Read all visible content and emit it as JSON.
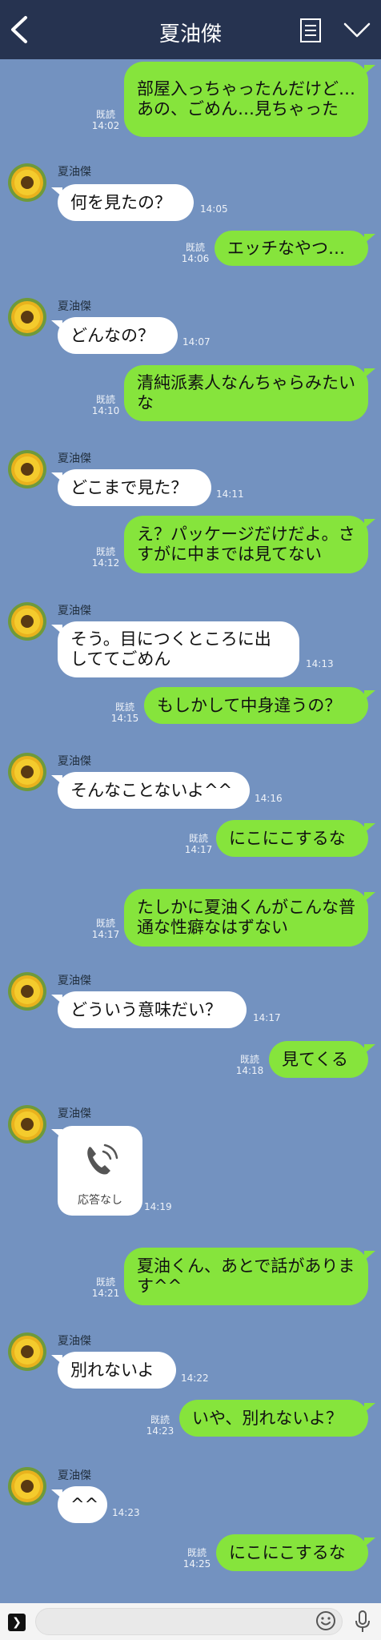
{
  "header": {
    "title": "夏油傑"
  },
  "contact": {
    "name": "夏油傑"
  },
  "read_label": "既読",
  "messages": [
    {
      "side": "out",
      "text": "部屋入っちゃったんだけど…あの、ごめん…見ちゃった",
      "time": "14:02"
    },
    {
      "side": "in",
      "text": "何を見たの？",
      "time": "14:05"
    },
    {
      "side": "out",
      "text": "エッチなやつ…",
      "time": "14:06"
    },
    {
      "side": "in",
      "text": "どんなの？",
      "time": "14:07"
    },
    {
      "side": "out",
      "text": "清純派素人なんちゃらみたいな",
      "time": "14:10"
    },
    {
      "side": "in",
      "text": "どこまで見た？",
      "time": "14:11"
    },
    {
      "side": "out",
      "text": "え？パッケージだけだよ。さすがに中までは見てない",
      "time": "14:12"
    },
    {
      "side": "in",
      "text": "そう。目につくところに出しててごめん",
      "time": "14:13"
    },
    {
      "side": "out",
      "text": "もしかして中身違うの？",
      "time": "14:15"
    },
    {
      "side": "in",
      "text": "そんなことないよ^^",
      "time": "14:16"
    },
    {
      "side": "out",
      "text": "にこにこするな",
      "time": "14:17"
    },
    {
      "side": "out",
      "text": "たしかに夏油くんがこんな普通な性癖なはずない",
      "time": "14:17"
    },
    {
      "side": "in",
      "text": "どういう意味だい？",
      "time": "14:17"
    },
    {
      "side": "out",
      "text": "見てくる",
      "time": "14:18"
    },
    {
      "side": "in",
      "type": "call",
      "text": "応答なし",
      "time": "14:19"
    },
    {
      "side": "out",
      "text": "夏油くん、あとで話があります^^",
      "time": "14:21"
    },
    {
      "side": "in",
      "text": "別れないよ",
      "time": "14:22"
    },
    {
      "side": "out",
      "text": "いや、別れないよ？",
      "time": "14:23"
    },
    {
      "side": "in",
      "text": "^^",
      "time": "14:23"
    },
    {
      "side": "out",
      "text": "にこにこするな",
      "time": "14:25"
    }
  ],
  "icons": {
    "back": "chevron-left-icon",
    "notes": "notes-icon",
    "menu": "chevron-down-icon",
    "avatar": "sunflower-avatar",
    "call": "missed-call-icon",
    "more": "expand-icon",
    "emoji": "emoji-icon",
    "mic": "mic-icon"
  },
  "colors": {
    "header_bg": "#263350",
    "chat_bg": "#7392c0",
    "outgoing_bubble": "#86e43c",
    "incoming_bubble": "#ffffff"
  }
}
